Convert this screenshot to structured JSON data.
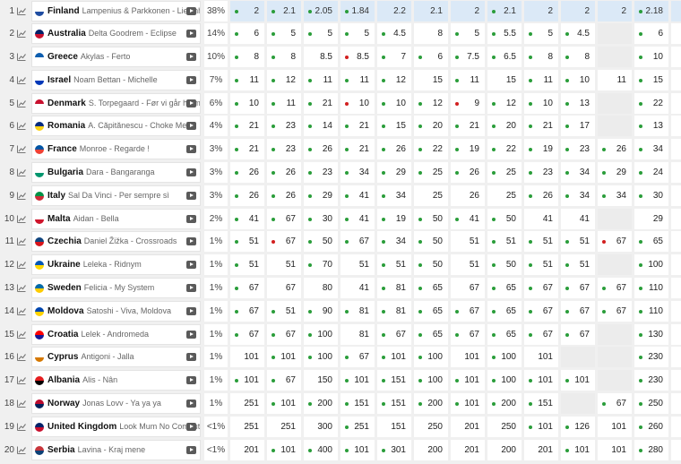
{
  "rows": [
    {
      "rank": "1",
      "flag": "finland",
      "flag_colors": [
        "#ffffff",
        "#1f4da1"
      ],
      "country": "Finland",
      "song": "Lampenius & Parkkonen - Liekinheitin",
      "pct": "38%",
      "odds": [
        [
          "g",
          "2"
        ],
        [
          "g",
          "2.1"
        ],
        [
          "g",
          "2.05"
        ],
        [
          "g",
          "1.84"
        ],
        [
          "n",
          "2.2"
        ],
        [
          "n",
          "2.1"
        ],
        [
          "n",
          "2"
        ],
        [
          "g",
          "2.1"
        ],
        [
          "n",
          "2"
        ],
        [
          "n",
          "2"
        ],
        [
          "n",
          "2"
        ],
        [
          "g",
          "2.18"
        ],
        [
          "n",
          "2.14"
        ]
      ]
    },
    {
      "rank": "2",
      "flag": "australia",
      "flag_colors": [
        "#012169",
        "#c8102e"
      ],
      "country": "Australia",
      "song": "Delta Goodrem - Eclipse",
      "pct": "14%",
      "odds": [
        [
          "g",
          "6"
        ],
        [
          "g",
          "5"
        ],
        [
          "g",
          "5"
        ],
        [
          "g",
          "5"
        ],
        [
          "g",
          "4.5"
        ],
        [
          "n",
          "8"
        ],
        [
          "g",
          "5"
        ],
        [
          "g",
          "5.5"
        ],
        [
          "g",
          "5"
        ],
        [
          "g",
          "4.5"
        ],
        [
          "x",
          ""
        ],
        [
          "g",
          "6"
        ],
        [
          "n",
          "6"
        ]
      ]
    },
    {
      "rank": "3",
      "flag": "greece",
      "flag_colors": [
        "#0d5eaf",
        "#ffffff"
      ],
      "country": "Greece",
      "song": "Akylas - Ferto",
      "pct": "10%",
      "odds": [
        [
          "g",
          "8"
        ],
        [
          "g",
          "8"
        ],
        [
          "n",
          "8.5"
        ],
        [
          "r",
          "8.5"
        ],
        [
          "g",
          "7"
        ],
        [
          "g",
          "6"
        ],
        [
          "g",
          "7.5"
        ],
        [
          "g",
          "6.5"
        ],
        [
          "g",
          "8"
        ],
        [
          "g",
          "8"
        ],
        [
          "x",
          ""
        ],
        [
          "g",
          "10"
        ],
        [
          "n",
          "10"
        ]
      ]
    },
    {
      "rank": "4",
      "flag": "israel",
      "flag_colors": [
        "#ffffff",
        "#0038b8"
      ],
      "country": "Israel",
      "song": "Noam Bettan - Michelle",
      "pct": "7%",
      "odds": [
        [
          "g",
          "11"
        ],
        [
          "g",
          "12"
        ],
        [
          "g",
          "11"
        ],
        [
          "g",
          "11"
        ],
        [
          "g",
          "12"
        ],
        [
          "n",
          "15"
        ],
        [
          "g",
          "11"
        ],
        [
          "n",
          "15"
        ],
        [
          "g",
          "11"
        ],
        [
          "g",
          "10"
        ],
        [
          "n",
          "11"
        ],
        [
          "g",
          "15"
        ],
        [
          "n",
          "14"
        ]
      ]
    },
    {
      "rank": "5",
      "flag": "denmark",
      "flag_colors": [
        "#c8102e",
        "#ffffff"
      ],
      "country": "Denmark",
      "song": "S. Torpegaard - Før vi går hjem",
      "pct": "6%",
      "odds": [
        [
          "g",
          "10"
        ],
        [
          "g",
          "11"
        ],
        [
          "g",
          "21"
        ],
        [
          "r",
          "10"
        ],
        [
          "g",
          "10"
        ],
        [
          "g",
          "12"
        ],
        [
          "r",
          "9"
        ],
        [
          "g",
          "12"
        ],
        [
          "g",
          "10"
        ],
        [
          "g",
          "13"
        ],
        [
          "x",
          ""
        ],
        [
          "g",
          "22"
        ],
        [
          "n",
          "27"
        ]
      ]
    },
    {
      "rank": "6",
      "flag": "romania",
      "flag_colors": [
        "#002b7f",
        "#fcd116"
      ],
      "country": "Romania",
      "song": "A. Căpitănescu - Choke Me",
      "pct": "4%",
      "odds": [
        [
          "g",
          "21"
        ],
        [
          "g",
          "23"
        ],
        [
          "g",
          "14"
        ],
        [
          "g",
          "21"
        ],
        [
          "g",
          "15"
        ],
        [
          "g",
          "20"
        ],
        [
          "g",
          "21"
        ],
        [
          "g",
          "20"
        ],
        [
          "g",
          "21"
        ],
        [
          "g",
          "17"
        ],
        [
          "x",
          ""
        ],
        [
          "g",
          "13"
        ],
        [
          "n",
          "18"
        ]
      ]
    },
    {
      "rank": "7",
      "flag": "france",
      "flag_colors": [
        "#0055a4",
        "#ef4135"
      ],
      "country": "France",
      "song": "Monroe - Regarde !",
      "pct": "3%",
      "odds": [
        [
          "g",
          "21"
        ],
        [
          "g",
          "23"
        ],
        [
          "g",
          "26"
        ],
        [
          "g",
          "21"
        ],
        [
          "g",
          "26"
        ],
        [
          "g",
          "22"
        ],
        [
          "g",
          "19"
        ],
        [
          "g",
          "22"
        ],
        [
          "g",
          "19"
        ],
        [
          "g",
          "23"
        ],
        [
          "g",
          "26"
        ],
        [
          "g",
          "34"
        ],
        [
          "n",
          "46"
        ]
      ]
    },
    {
      "rank": "8",
      "flag": "bulgaria",
      "flag_colors": [
        "#ffffff",
        "#00966e"
      ],
      "country": "Bulgaria",
      "song": "Dara - Bangaranga",
      "pct": "3%",
      "odds": [
        [
          "g",
          "26"
        ],
        [
          "g",
          "26"
        ],
        [
          "g",
          "23"
        ],
        [
          "g",
          "34"
        ],
        [
          "g",
          "29"
        ],
        [
          "g",
          "25"
        ],
        [
          "g",
          "26"
        ],
        [
          "g",
          "25"
        ],
        [
          "g",
          "23"
        ],
        [
          "g",
          "34"
        ],
        [
          "g",
          "29"
        ],
        [
          "g",
          "24"
        ],
        [
          "n",
          "30"
        ]
      ]
    },
    {
      "rank": "9",
      "flag": "italy",
      "flag_colors": [
        "#009246",
        "#ce2b37"
      ],
      "country": "Italy",
      "song": "Sal Da Vinci - Per sempre sì",
      "pct": "3%",
      "odds": [
        [
          "g",
          "26"
        ],
        [
          "g",
          "26"
        ],
        [
          "g",
          "29"
        ],
        [
          "g",
          "41"
        ],
        [
          "g",
          "34"
        ],
        [
          "n",
          "25"
        ],
        [
          "n",
          "26"
        ],
        [
          "n",
          "25"
        ],
        [
          "g",
          "26"
        ],
        [
          "g",
          "34"
        ],
        [
          "g",
          "34"
        ],
        [
          "g",
          "30"
        ],
        [
          "n",
          "46"
        ]
      ]
    },
    {
      "rank": "10",
      "flag": "malta",
      "flag_colors": [
        "#ffffff",
        "#cf142b"
      ],
      "country": "Malta",
      "song": "Aidan - Bella",
      "pct": "2%",
      "odds": [
        [
          "g",
          "41"
        ],
        [
          "g",
          "67"
        ],
        [
          "g",
          "30"
        ],
        [
          "g",
          "41"
        ],
        [
          "g",
          "19"
        ],
        [
          "g",
          "50"
        ],
        [
          "g",
          "41"
        ],
        [
          "g",
          "50"
        ],
        [
          "n",
          "41"
        ],
        [
          "n",
          "41"
        ],
        [
          "x",
          ""
        ],
        [
          "n",
          "29"
        ],
        [
          "n",
          "34"
        ]
      ]
    },
    {
      "rank": "11",
      "flag": "czechia",
      "flag_colors": [
        "#11457e",
        "#d7141a"
      ],
      "country": "Czechia",
      "song": "Daniel Žižka - Crossroads",
      "pct": "1%",
      "odds": [
        [
          "g",
          "51"
        ],
        [
          "r",
          "67"
        ],
        [
          "g",
          "50"
        ],
        [
          "g",
          "67"
        ],
        [
          "g",
          "34"
        ],
        [
          "g",
          "50"
        ],
        [
          "n",
          "51"
        ],
        [
          "g",
          "51"
        ],
        [
          "g",
          "51"
        ],
        [
          "g",
          "51"
        ],
        [
          "r",
          "67"
        ],
        [
          "g",
          "65"
        ],
        [
          "n",
          "95"
        ]
      ]
    },
    {
      "rank": "12",
      "flag": "ukraine",
      "flag_colors": [
        "#0057b7",
        "#ffd700"
      ],
      "country": "Ukraine",
      "song": "Leleka - Ridnym",
      "pct": "1%",
      "odds": [
        [
          "g",
          "51"
        ],
        [
          "n",
          "51"
        ],
        [
          "g",
          "70"
        ],
        [
          "n",
          "51"
        ],
        [
          "g",
          "51"
        ],
        [
          "g",
          "50"
        ],
        [
          "n",
          "51"
        ],
        [
          "g",
          "50"
        ],
        [
          "g",
          "51"
        ],
        [
          "g",
          "51"
        ],
        [
          "x",
          ""
        ],
        [
          "g",
          "100"
        ],
        [
          "n",
          "110"
        ]
      ]
    },
    {
      "rank": "13",
      "flag": "sweden",
      "flag_colors": [
        "#006aa7",
        "#fecc00"
      ],
      "country": "Sweden",
      "song": "Felicia - My System",
      "pct": "1%",
      "odds": [
        [
          "g",
          "67"
        ],
        [
          "n",
          "67"
        ],
        [
          "n",
          "80"
        ],
        [
          "n",
          "41"
        ],
        [
          "g",
          "81"
        ],
        [
          "g",
          "65"
        ],
        [
          "n",
          "67"
        ],
        [
          "g",
          "65"
        ],
        [
          "g",
          "67"
        ],
        [
          "g",
          "67"
        ],
        [
          "g",
          "67"
        ],
        [
          "g",
          "110"
        ],
        [
          "n",
          "140"
        ]
      ]
    },
    {
      "rank": "14",
      "flag": "moldova",
      "flag_colors": [
        "#0046ae",
        "#ffd200"
      ],
      "country": "Moldova",
      "song": "Satoshi - Viva, Moldova",
      "pct": "1%",
      "odds": [
        [
          "g",
          "67"
        ],
        [
          "g",
          "51"
        ],
        [
          "g",
          "90"
        ],
        [
          "g",
          "81"
        ],
        [
          "g",
          "81"
        ],
        [
          "g",
          "65"
        ],
        [
          "g",
          "67"
        ],
        [
          "g",
          "65"
        ],
        [
          "g",
          "67"
        ],
        [
          "g",
          "67"
        ],
        [
          "g",
          "67"
        ],
        [
          "g",
          "110"
        ],
        [
          "n",
          "140"
        ]
      ]
    },
    {
      "rank": "15",
      "flag": "croatia",
      "flag_colors": [
        "#ff0000",
        "#171796"
      ],
      "country": "Croatia",
      "song": "Lelek - Andromeda",
      "pct": "1%",
      "odds": [
        [
          "g",
          "67"
        ],
        [
          "g",
          "67"
        ],
        [
          "g",
          "100"
        ],
        [
          "n",
          "81"
        ],
        [
          "g",
          "67"
        ],
        [
          "g",
          "65"
        ],
        [
          "g",
          "67"
        ],
        [
          "g",
          "65"
        ],
        [
          "g",
          "67"
        ],
        [
          "g",
          "67"
        ],
        [
          "x",
          ""
        ],
        [
          "g",
          "130"
        ],
        [
          "n",
          "140"
        ]
      ]
    },
    {
      "rank": "16",
      "flag": "cyprus",
      "flag_colors": [
        "#ffffff",
        "#d57800"
      ],
      "country": "Cyprus",
      "song": "Antigoni - Jalla",
      "pct": "1%",
      "odds": [
        [
          "n",
          "101"
        ],
        [
          "g",
          "101"
        ],
        [
          "g",
          "100"
        ],
        [
          "g",
          "67"
        ],
        [
          "g",
          "101"
        ],
        [
          "g",
          "100"
        ],
        [
          "n",
          "101"
        ],
        [
          "g",
          "100"
        ],
        [
          "n",
          "101"
        ],
        [
          "x",
          ""
        ],
        [
          "x",
          ""
        ],
        [
          "g",
          "230"
        ],
        [
          "n",
          "200"
        ]
      ]
    },
    {
      "rank": "17",
      "flag": "albania",
      "flag_colors": [
        "#e41e20",
        "#000000"
      ],
      "country": "Albania",
      "song": "Alis - Nân",
      "pct": "1%",
      "odds": [
        [
          "g",
          "101"
        ],
        [
          "g",
          "67"
        ],
        [
          "n",
          "150"
        ],
        [
          "g",
          "101"
        ],
        [
          "g",
          "151"
        ],
        [
          "g",
          "100"
        ],
        [
          "g",
          "101"
        ],
        [
          "g",
          "100"
        ],
        [
          "g",
          "101"
        ],
        [
          "g",
          "101"
        ],
        [
          "x",
          ""
        ],
        [
          "g",
          "230"
        ],
        [
          "n",
          "250"
        ]
      ]
    },
    {
      "rank": "18",
      "flag": "norway",
      "flag_colors": [
        "#ba0c2f",
        "#00205b"
      ],
      "country": "Norway",
      "song": "Jonas Lovv - Ya ya ya",
      "pct": "1%",
      "odds": [
        [
          "n",
          "251"
        ],
        [
          "g",
          "101"
        ],
        [
          "g",
          "200"
        ],
        [
          "g",
          "151"
        ],
        [
          "g",
          "151"
        ],
        [
          "g",
          "200"
        ],
        [
          "g",
          "101"
        ],
        [
          "g",
          "200"
        ],
        [
          "g",
          "151"
        ],
        [
          "x",
          ""
        ],
        [
          "g",
          "67"
        ],
        [
          "g",
          "250"
        ],
        [
          "n",
          "350"
        ]
      ]
    },
    {
      "rank": "19",
      "flag": "united-kingdom",
      "flag_colors": [
        "#012169",
        "#c8102e"
      ],
      "country": "United Kingdom",
      "song": "Look Mum No Computer ...",
      "pct": "<1%",
      "odds": [
        [
          "n",
          "251"
        ],
        [
          "n",
          "251"
        ],
        [
          "n",
          "300"
        ],
        [
          "g",
          "251"
        ],
        [
          "n",
          "151"
        ],
        [
          "n",
          "250"
        ],
        [
          "n",
          "201"
        ],
        [
          "n",
          "250"
        ],
        [
          "g",
          "101"
        ],
        [
          "g",
          "126"
        ],
        [
          "n",
          "101"
        ],
        [
          "g",
          "260"
        ],
        [
          "n",
          "630"
        ]
      ]
    },
    {
      "rank": "20",
      "flag": "serbia",
      "flag_colors": [
        "#c6363c",
        "#0c4076"
      ],
      "country": "Serbia",
      "song": "Lavina - Kraj mene",
      "pct": "<1%",
      "odds": [
        [
          "n",
          "201"
        ],
        [
          "g",
          "101"
        ],
        [
          "g",
          "400"
        ],
        [
          "g",
          "101"
        ],
        [
          "g",
          "301"
        ],
        [
          "n",
          "200"
        ],
        [
          "n",
          "201"
        ],
        [
          "n",
          "200"
        ],
        [
          "n",
          "201"
        ],
        [
          "g",
          "101"
        ],
        [
          "n",
          "101"
        ],
        [
          "g",
          "280"
        ],
        [
          "n",
          "630"
        ]
      ]
    }
  ],
  "icons": {
    "trend": "trend-chart-icon",
    "play": "video-play-icon",
    "dot": "odds-movement-dot"
  },
  "colors": {
    "accent_highlight": "#dbe9f7",
    "up": "#2a9d3a",
    "down": "#d21f1f"
  }
}
